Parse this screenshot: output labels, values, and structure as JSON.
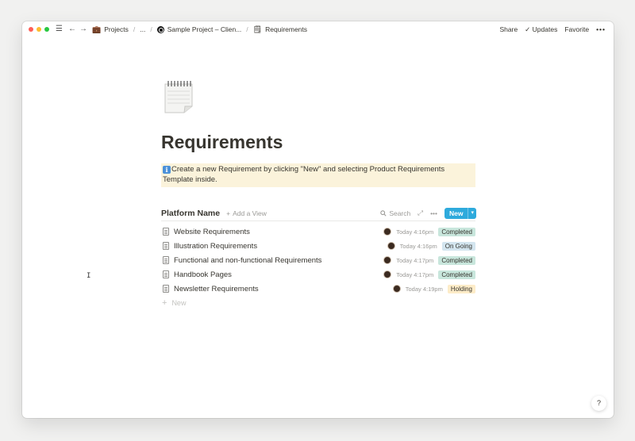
{
  "titlebar": {
    "breadcrumbs": [
      {
        "icon": "briefcase-icon",
        "emoji": "💼",
        "label": "Projects"
      },
      {
        "label": "..."
      },
      {
        "icon": "project-logo-icon",
        "label": "Sample Project – Clien..."
      },
      {
        "icon": "notepad-icon",
        "emoji": "🗒",
        "label": "Requirements"
      }
    ],
    "actions": {
      "share": "Share",
      "updates": "Updates",
      "favorite": "Favorite",
      "more": "•••"
    }
  },
  "page": {
    "icon": "notepad-icon",
    "title": "Requirements",
    "callout": {
      "icon": "info-icon",
      "icon_glyph": "i",
      "text": "Create a new Requirement by clicking \"New\" and selecting Product Requirements Template inside."
    }
  },
  "database": {
    "title": "Platform Name",
    "add_view": "Add a View",
    "search": "Search",
    "new_button": "New",
    "rows": [
      {
        "title": "Website Requirements",
        "time": "Today 4:16pm",
        "status": "Completed",
        "status_color": "#c8e6dc"
      },
      {
        "title": "Illustration Requirements",
        "time": "Today 4:16pm",
        "status": "On Going",
        "status_color": "#d3e5ef"
      },
      {
        "title": "Functional and non-functional Requirements",
        "time": "Today 4:17pm",
        "status": "Completed",
        "status_color": "#c8e6dc"
      },
      {
        "title": "Handbook Pages",
        "time": "Today 4:17pm",
        "status": "Completed",
        "status_color": "#c8e6dc"
      },
      {
        "title": "Newsletter Requirements",
        "time": "Today 4:19pm",
        "status": "Holding",
        "status_color": "#fdecc8"
      }
    ],
    "new_row": "New"
  },
  "help": "?",
  "colors": {
    "accent": "#2eaadc",
    "callout_bg": "#fbf3db",
    "text": "#37352f",
    "muted": "#9b9a97"
  }
}
